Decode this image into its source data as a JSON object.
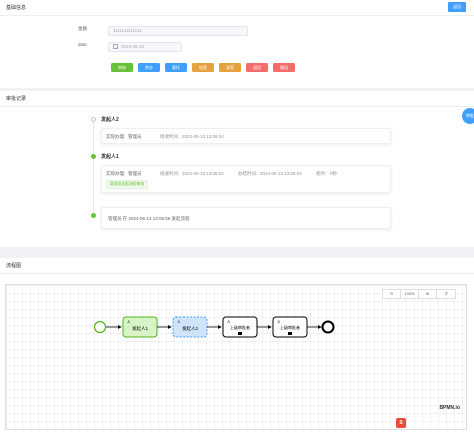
{
  "basic": {
    "title": "基础信息",
    "back_label": "返回",
    "fields": [
      {
        "label": "金额",
        "value": "1111111111111"
      },
      {
        "label": "date",
        "value": "2024-06-13"
      }
    ],
    "buttons": [
      {
        "label": "审核",
        "color": "#67c23a"
      },
      {
        "label": "转办",
        "color": "#409eff"
      },
      {
        "label": "委托",
        "color": "#409eff"
      },
      {
        "label": "加签",
        "color": "#e6a23c"
      },
      {
        "label": "减签",
        "color": "#e6a23c"
      },
      {
        "label": "退回",
        "color": "#f56c6c"
      },
      {
        "label": "撤回",
        "color": "#f56c6c"
      }
    ]
  },
  "audit": {
    "title": "审批记录",
    "side_badge": "审批",
    "entries": [
      {
        "title": "发起人2",
        "handler_label": "实际办理:",
        "handler": "管理员",
        "receive_label": "接收时间:",
        "receive_time": "2024-06-13 13:06:04"
      },
      {
        "title": "发起人1",
        "handler_label": "实际办理:",
        "handler": "管理员",
        "receive_label": "接收时间:",
        "receive_time": "2024-06-13 13:06:04",
        "handle_label": "办结时间:",
        "handle_time": "2024-06-13 13:06:04",
        "cost_label": "耗时:",
        "cost": "0秒",
        "tag": "管理员发起流程审批"
      },
      {
        "text": "管理员 在 2024-06-13 13:06:56 发起流程"
      }
    ]
  },
  "flow": {
    "title": "流程图",
    "zoom": "100%",
    "nodes": [
      "发起人1",
      "发起人2",
      "上级审批者",
      "上级审批者"
    ],
    "logo": "BPMN.io",
    "watermark": "CSDN @阿霖说"
  }
}
